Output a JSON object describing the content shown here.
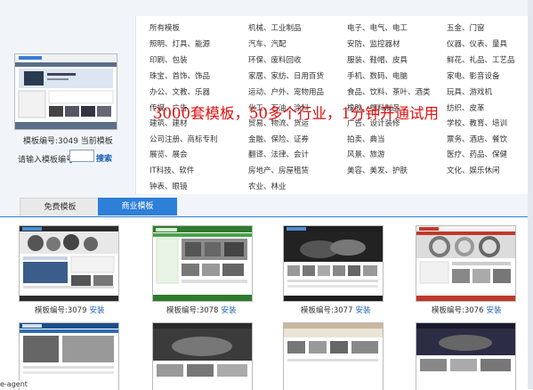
{
  "current": {
    "label": "模板编号:3049  当前模板"
  },
  "search": {
    "label": "请输入模板编号",
    "value": "",
    "button": "搜索"
  },
  "categories": [
    [
      "所有模板",
      "机械、工业制品",
      "电子、电气、电工",
      "五金、门窗"
    ],
    [
      "照明、灯具、能源",
      "汽车、汽配",
      "安防、监控器材",
      "仪器、仪表、量具"
    ],
    [
      "印刷、包装",
      "环保、废料回收",
      "服装、鞋帽、皮具",
      "鲜花、礼品、工艺品"
    ],
    [
      "珠宝、首饰、饰品",
      "家居、家纺、日用百货",
      "手机、数码、电脑",
      "家电、影音设备"
    ],
    [
      "办公、文教、乐器",
      "运动、户外、宠物用品",
      "食品、饮料、茶叶、酒类",
      "玩具、游戏机"
    ],
    [
      "传媒、广告",
      "化工、石油、涂料",
      "橡胶、塑料制品",
      "纺织、皮革"
    ],
    [
      "建筑、建材",
      "贸易、物流、货运",
      "广告、设计装修",
      "学校、教育、培训"
    ],
    [
      "公司注册、商标专利",
      "金融、保险、证券",
      "拍卖、典当",
      "票务、酒店、餐饮"
    ],
    [
      "展览、展会",
      "翻译、法律、会计",
      "风景、旅游",
      "医疗、药品、保健"
    ],
    [
      "IT科技、软件",
      "房地产、房屋租赁",
      "美容、美发、护肤",
      "文化、娱乐休闲"
    ],
    [
      "钟表、眼镜",
      "农业、林业",
      "",
      ""
    ]
  ],
  "promo": "3000套模板，50多个行业，1分钟开通试用",
  "tabs": {
    "free": "免费模板",
    "business": "商业模板"
  },
  "install_label": "安装",
  "templates": [
    {
      "caption": "模板编号:3079"
    },
    {
      "caption": "模板编号:3078"
    },
    {
      "caption": "模板编号:3077"
    },
    {
      "caption": "模板编号:3076"
    }
  ],
  "status": "e-agent"
}
